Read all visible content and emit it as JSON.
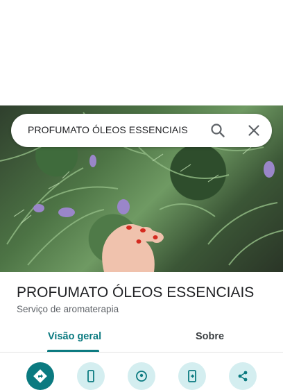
{
  "search": {
    "query": "PROFUMATO ÓLEOS ESSENCIAIS"
  },
  "place": {
    "name": "PROFUMATO ÓLEOS ESSENCIAIS",
    "category": "Serviço de aromaterapia"
  },
  "tabs": [
    {
      "label": "Visão geral",
      "active": true
    },
    {
      "label": "Sobre",
      "active": false
    }
  ],
  "actions": [
    {
      "icon": "directions-icon",
      "primary": true
    },
    {
      "icon": "phone-icon"
    },
    {
      "icon": "nearby-icon"
    },
    {
      "icon": "send-to-phone-icon"
    },
    {
      "icon": "share-icon"
    }
  ],
  "colors": {
    "accent": "#0b7a80",
    "action_bg": "#d4eef0",
    "text_primary": "#202124",
    "text_secondary": "#5f6368"
  }
}
